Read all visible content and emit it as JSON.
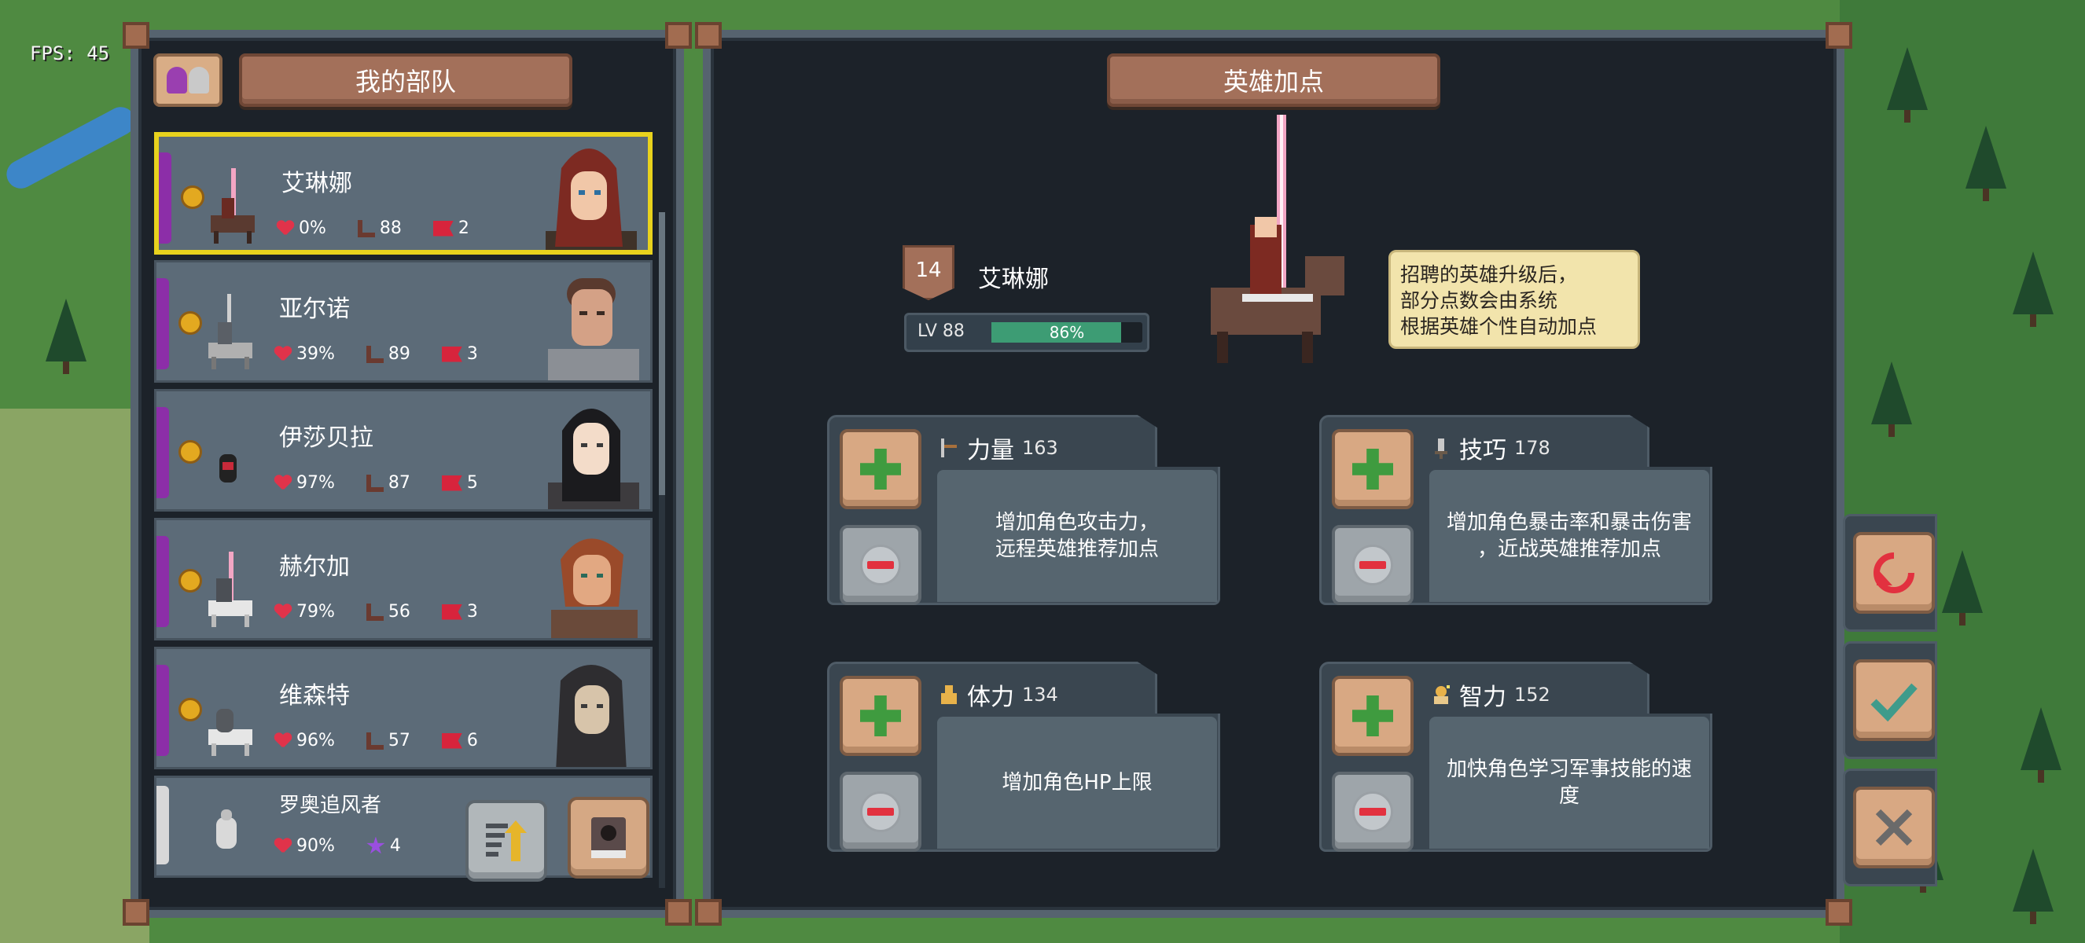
{
  "hud": {
    "fps": "FPS: 45"
  },
  "left_panel": {
    "title": "我的部队",
    "heroes": [
      {
        "name": "艾琳娜",
        "hp": "0%",
        "stat2": "88",
        "stat3": "2",
        "selected": true,
        "portrait_hair": "#7d2a22",
        "portrait_skin": "#f1c7a8",
        "portrait_cloth": "#3f3229"
      },
      {
        "name": "亚尔诺",
        "hp": "39%",
        "stat2": "89",
        "stat3": "3",
        "selected": false,
        "portrait_hair": "#5a3a2e",
        "portrait_skin": "#d4a186",
        "portrait_cloth": "#8b8f95"
      },
      {
        "name": "伊莎贝拉",
        "hp": "97%",
        "stat2": "87",
        "stat3": "5",
        "selected": false,
        "portrait_hair": "#1b1b1e",
        "portrait_skin": "#f3dcc9",
        "portrait_cloth": "#3d3b3e"
      },
      {
        "name": "赫尔加",
        "hp": "79%",
        "stat2": "56",
        "stat3": "3",
        "selected": false,
        "portrait_hair": "#9a4a2a",
        "portrait_skin": "#e2a882",
        "portrait_cloth": "#6a4a3a"
      },
      {
        "name": "维森特",
        "hp": "96%",
        "stat2": "57",
        "stat3": "6",
        "selected": false,
        "portrait_hair": "#2a2a2c",
        "portrait_skin": "#d7c4aa",
        "portrait_cloth": "#2e2d30"
      },
      {
        "name": "罗奥追风者",
        "hp": "90%",
        "stat2": "4",
        "stat3": "",
        "selected": false,
        "portrait_hair": "",
        "portrait_skin": "",
        "portrait_cloth": ""
      }
    ]
  },
  "right_panel": {
    "title": "英雄加点",
    "hero": {
      "level_badge": "14",
      "name": "艾琳娜",
      "lv_label": "LV 88",
      "xp_percent": "86%",
      "xp_fraction": 0.86
    },
    "tooltip": [
      "招聘的英雄升级后，",
      "部分点数会由系统",
      "根据英雄个性自动加点"
    ],
    "attributes": [
      {
        "name": "力量",
        "value": "163",
        "desc": [
          "增加角色攻击力，",
          "远程英雄推荐加点"
        ],
        "icon": "sword-icon"
      },
      {
        "name": "技巧",
        "value": "178",
        "desc": [
          "增加角色暴击率和暴击伤害",
          "，近战英雄推荐加点"
        ],
        "icon": "dagger-icon"
      },
      {
        "name": "体力",
        "value": "134",
        "desc": [
          "增加角色HP上限"
        ],
        "icon": "body-icon"
      },
      {
        "name": "智力",
        "value": "152",
        "desc": [
          "加快角色学习军事技能的速",
          "度"
        ],
        "icon": "brain-icon"
      }
    ]
  },
  "colors": {
    "accent_brown": "#a3705a",
    "selected_border": "#e8d21d",
    "xp_green": "#3d9c74",
    "plus_green": "#3f9b3f",
    "minus_red": "#e2313f"
  }
}
